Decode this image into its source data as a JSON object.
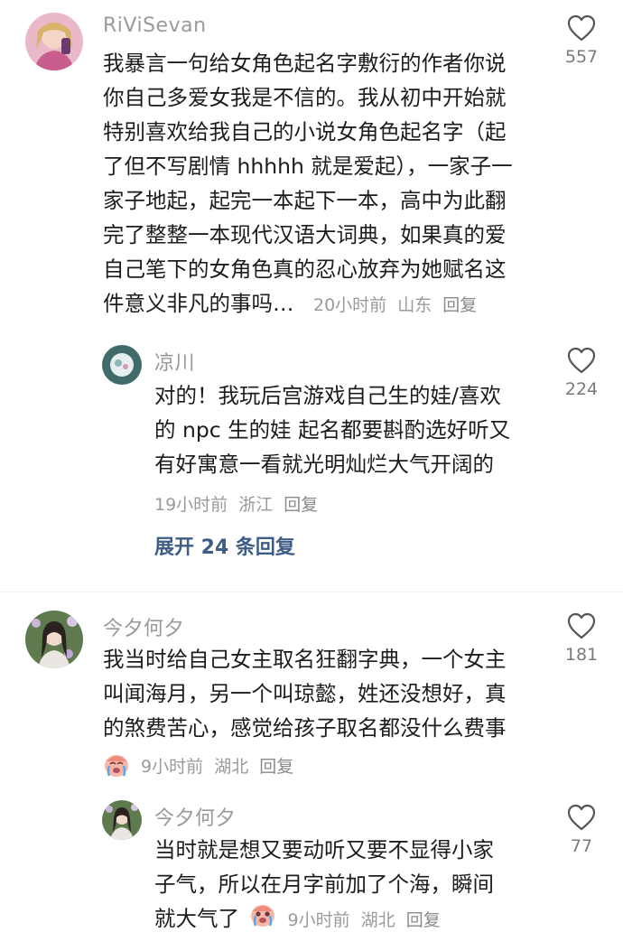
{
  "comments": [
    {
      "username": "RiViSevan",
      "lines": [
        "我暴言一句给女角色起名字敷衍的作者你说",
        "你自己多爱女我是不信的。我从初中开始就",
        "特别喜欢给我自己的小说女角色起名字（起",
        "了但不写剧情 hhhhh 就是爱起），一家子一",
        "家子地起，起完一本起下一本，高中为此翻",
        "完了整整一本现代汉语大词典，如果真的爱",
        "自己笔下的女角色真的忍心放弃为她赋名这",
        "件意义非凡的事吗…"
      ],
      "time": "20小时前",
      "location": "山东",
      "reply_label": "回复",
      "likes": "557"
    },
    {
      "username": "凉川",
      "lines": [
        "对的！我玩后宫游戏自己生的娃/喜欢",
        "的 npc 生的娃 起名都要斟酌选好听又",
        "有好寓意一看就光明灿烂大气开阔的"
      ],
      "time": "19小时前",
      "location": "浙江",
      "reply_label": "回复",
      "likes": "224",
      "expand_label": "展开 24 条回复"
    },
    {
      "username": "今夕何夕",
      "lines": [
        "我当时给自己女主取名狂翻字典，一个女主",
        "叫闻海月，另一个叫琼懿，姓还没想好，真",
        "的煞费苦心，感觉给孩子取名都没什么费事"
      ],
      "time": "9小时前",
      "location": "湖北",
      "reply_label": "回复",
      "likes": "181"
    },
    {
      "username": "今夕何夕",
      "lines": [
        "当时就是想又要动听又要不显得小家",
        "子气，所以在月字前加了个海，瞬间",
        "就大气了"
      ],
      "time": "9小时前",
      "location": "湖北",
      "reply_label": "回复",
      "likes": "77"
    }
  ],
  "colors": {
    "meta": "#9a9a9a",
    "expand": "#3d5c86",
    "text": "#1c1c1c"
  }
}
